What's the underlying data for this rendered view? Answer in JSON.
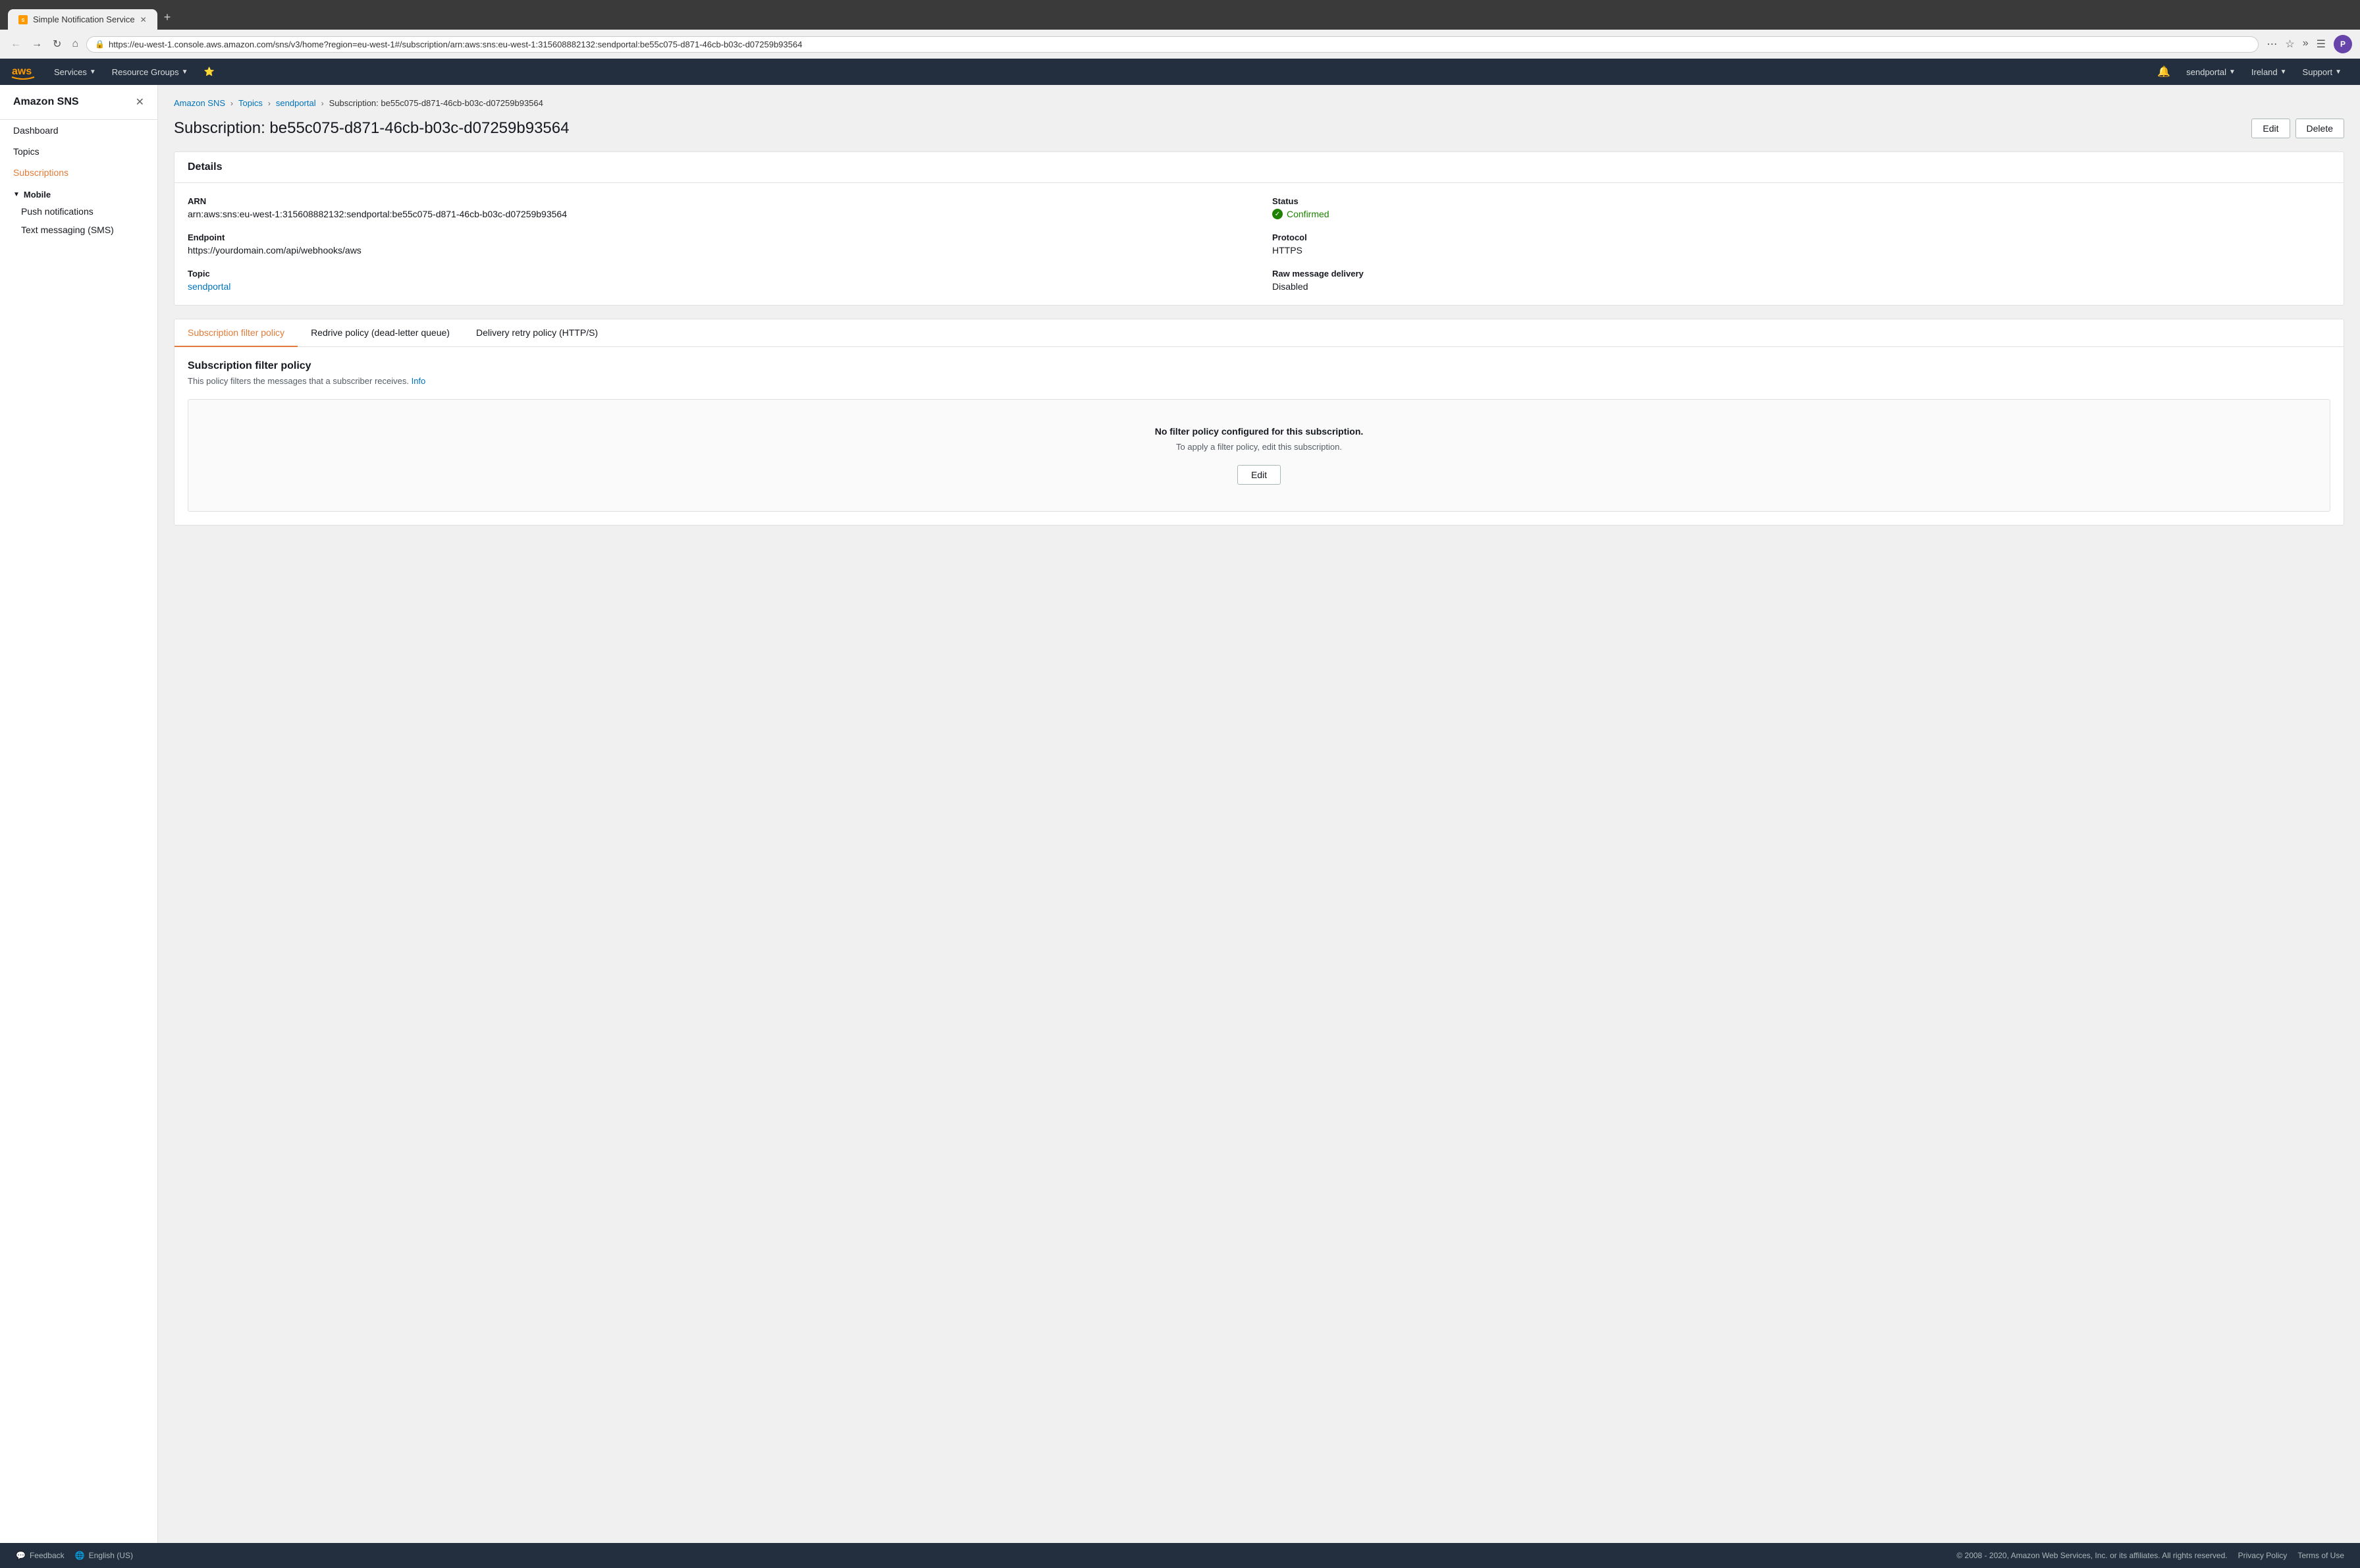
{
  "browser": {
    "tab_label": "Simple Notification Service",
    "tab_favicon_color": "#ff9900",
    "url": "https://eu-west-1.console.aws.amazon.com/sns/v3/home?region=eu-west-1#/subscription/arn:aws:sns:eu-west-1:315608882132:sendportal:be55c075-d871-46cb-b03c-d07259b93564",
    "new_tab_icon": "+",
    "back_icon": "←",
    "forward_icon": "→",
    "home_icon": "⌂",
    "lock_icon": "🔒",
    "extensions_icon": "⋯",
    "bookmark_icon": "☆",
    "user_avatar_initials": "P"
  },
  "topnav": {
    "logo_text": "aws",
    "services_label": "Services",
    "resource_groups_label": "Resource Groups",
    "pin_icon": "📌",
    "bell_icon": "🔔",
    "user_label": "sendportal",
    "region_label": "Ireland",
    "support_label": "Support"
  },
  "sidebar": {
    "title": "Amazon SNS",
    "close_icon": "✕",
    "items": [
      {
        "label": "Dashboard",
        "active": false,
        "id": "dashboard"
      },
      {
        "label": "Topics",
        "active": false,
        "id": "topics"
      },
      {
        "label": "Subscriptions",
        "active": true,
        "id": "subscriptions"
      }
    ],
    "mobile_section": "Mobile",
    "mobile_items": [
      {
        "label": "Push notifications",
        "id": "push-notifications"
      },
      {
        "label": "Text messaging (SMS)",
        "id": "text-messaging"
      }
    ]
  },
  "breadcrumb": {
    "items": [
      {
        "label": "Amazon SNS",
        "link": true
      },
      {
        "label": "Topics",
        "link": true
      },
      {
        "label": "sendportal",
        "link": true
      },
      {
        "label": "Subscription: be55c075-d871-46cb-b03c-d07259b93564",
        "link": false
      }
    ]
  },
  "page_title": "Subscription: be55c075-d871-46cb-b03c-d07259b93564",
  "actions": {
    "edit_label": "Edit",
    "delete_label": "Delete"
  },
  "details_panel": {
    "title": "Details",
    "fields": {
      "arn_label": "ARN",
      "arn_value": "arn:aws:sns:eu-west-1:315608882132:sendportal:be55c075-d871-46cb-b03c-d07259b93564",
      "status_label": "Status",
      "status_value": "Confirmed",
      "endpoint_label": "Endpoint",
      "endpoint_value": "https://yourdomain.com/api/webhooks/aws",
      "protocol_label": "Protocol",
      "protocol_value": "HTTPS",
      "topic_label": "Topic",
      "topic_value": "sendportal",
      "raw_message_label": "Raw message delivery",
      "raw_message_value": "Disabled"
    }
  },
  "tabs": {
    "items": [
      {
        "label": "Subscription filter policy",
        "active": true,
        "id": "filter-policy"
      },
      {
        "label": "Redrive policy (dead-letter queue)",
        "active": false,
        "id": "redrive-policy"
      },
      {
        "label": "Delivery retry policy (HTTP/S)",
        "active": false,
        "id": "retry-policy"
      }
    ]
  },
  "filter_policy": {
    "title": "Subscription filter policy",
    "description": "This policy filters the messages that a subscriber receives.",
    "info_link_label": "Info",
    "empty_title": "No filter policy configured for this subscription.",
    "empty_sub": "To apply a filter policy, edit this subscription.",
    "edit_label": "Edit"
  },
  "footer": {
    "feedback_label": "Feedback",
    "language_label": "English (US)",
    "copyright": "© 2008 - 2020, Amazon Web Services, Inc. or its affiliates. All rights reserved.",
    "privacy_label": "Privacy Policy",
    "terms_label": "Terms of Use"
  }
}
